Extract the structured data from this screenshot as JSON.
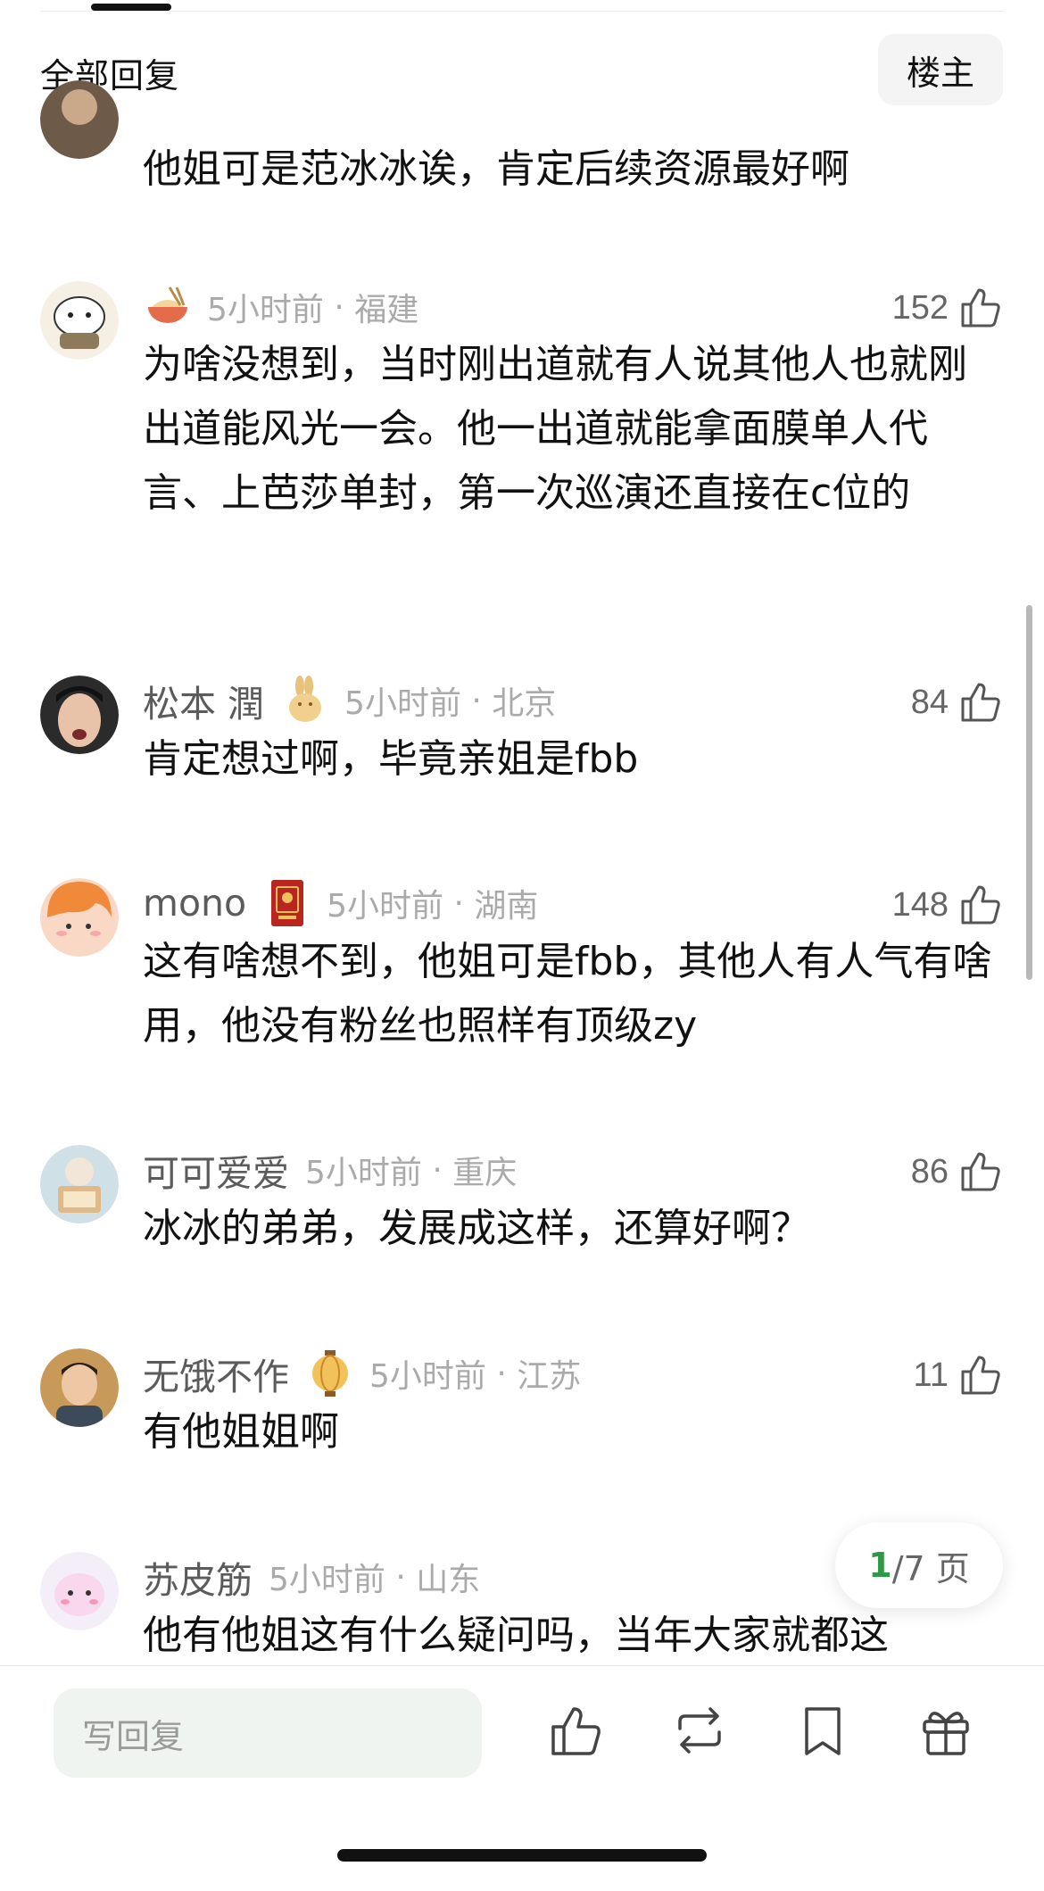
{
  "header": {
    "title": "全部回复",
    "filter_label": "楼主"
  },
  "comments": [
    {
      "text": "他姐可是范冰冰诶，肯定后续资源最好啊"
    },
    {
      "username": "",
      "time": "5小时前",
      "location": "福建",
      "likes": "152",
      "text": "为啥没想到，当时刚出道就有人说其他人也就刚出道能风光一会。他一出道就能拿面膜单人代言、上芭莎单封，第一次巡演还直接在c位的"
    },
    {
      "username": "松本 潤",
      "time": "5小时前",
      "location": "北京",
      "likes": "84",
      "text": "肯定想过啊，毕竟亲姐是fbb"
    },
    {
      "username": "mono",
      "time": "5小时前",
      "location": "湖南",
      "likes": "148",
      "text": "这有啥想不到，他姐可是fbb，其他人有人气有啥用，他没有粉丝也照样有顶级zy"
    },
    {
      "username": "可可爱爱",
      "time": "5小时前",
      "location": "重庆",
      "likes": "86",
      "text": "冰冰的弟弟，发展成这样，还算好啊？"
    },
    {
      "username": "无饿不作",
      "time": "5小时前",
      "location": "江苏",
      "likes": "11",
      "text": "有他姐姐啊"
    },
    {
      "username": "苏皮筋",
      "time": "5小时前",
      "location": "山东",
      "likes": "",
      "text": "他有他姐这有什么疑问吗，当年大家就都这"
    }
  ],
  "pager": {
    "current": "1",
    "rest": "/7 页"
  },
  "bottom_bar": {
    "reply_placeholder": "写回复",
    "icons": [
      "thumbs-up-icon",
      "repost-icon",
      "bookmark-icon",
      "gift-icon"
    ]
  },
  "colors": {
    "accent_green": "#2e9a47",
    "meta_gray": "#aaaaaa",
    "input_bg": "#eff4f0"
  }
}
